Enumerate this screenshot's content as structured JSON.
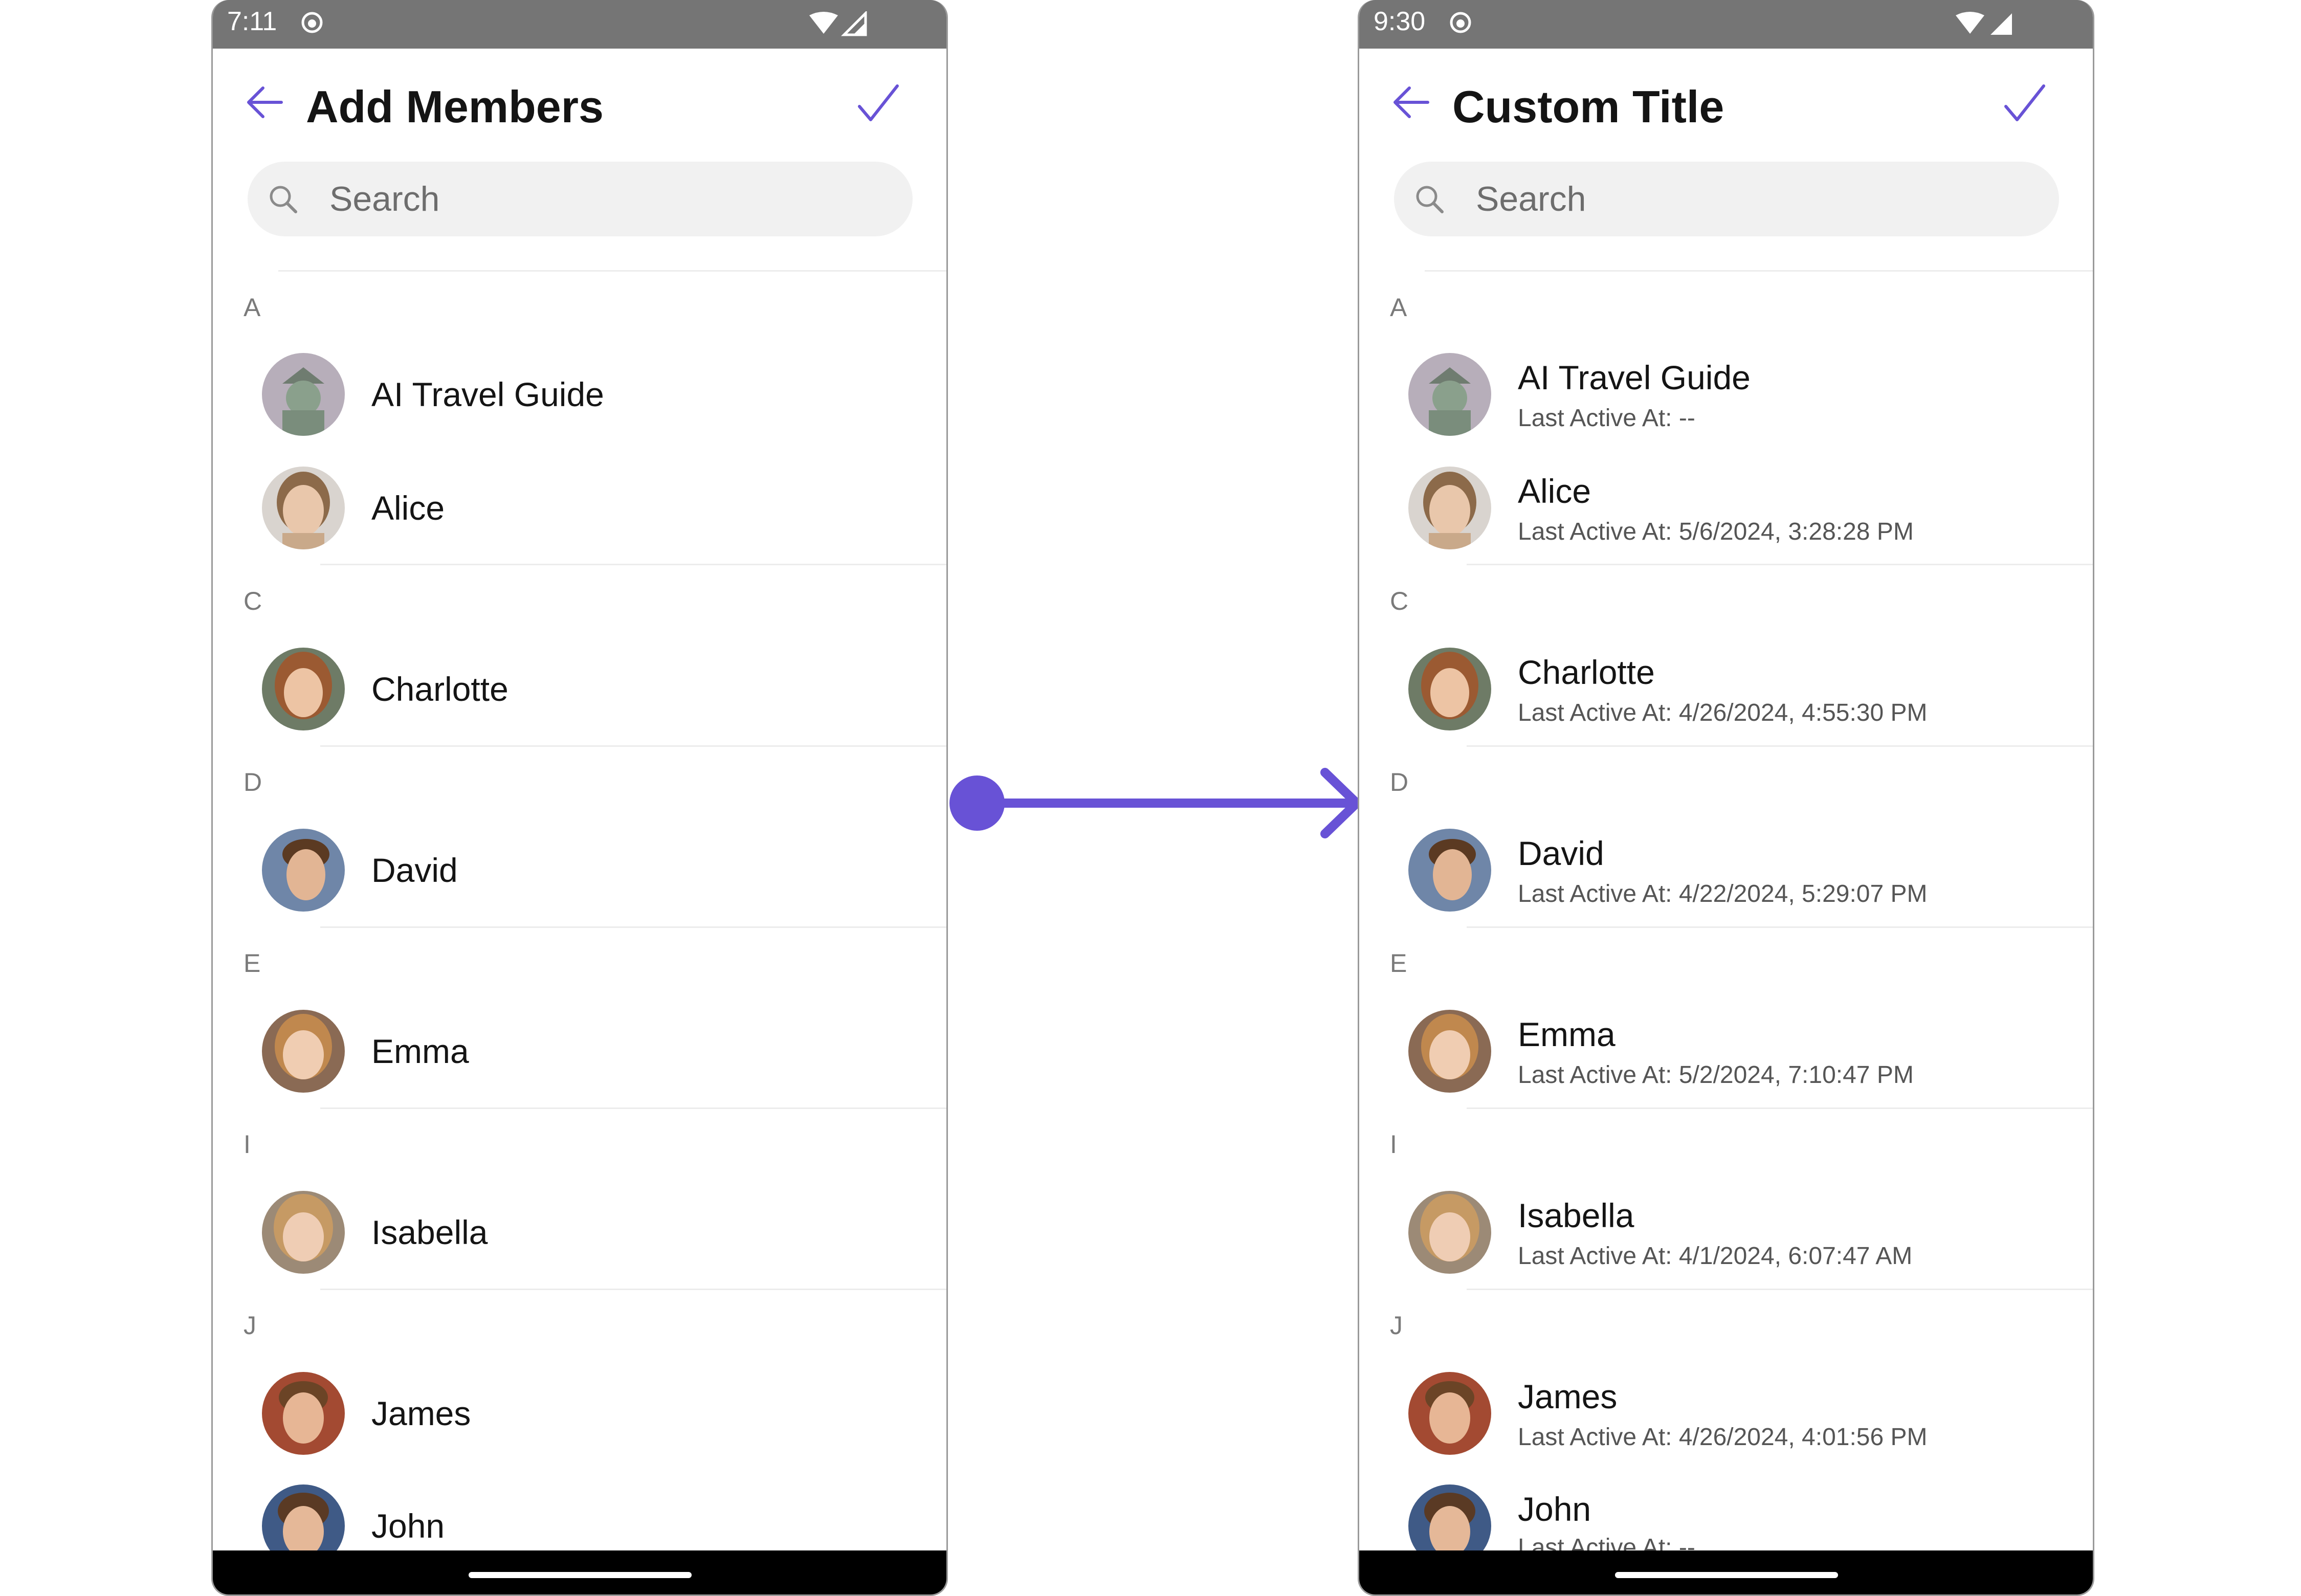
{
  "accent_color": "#6852d6",
  "left_screen": {
    "status_time": "7:11",
    "title": "Add Members",
    "search_placeholder": "Search",
    "sections": [
      {
        "letter": "A"
      },
      {
        "letter": "C"
      },
      {
        "letter": "D"
      },
      {
        "letter": "E"
      },
      {
        "letter": "I"
      },
      {
        "letter": "J"
      }
    ],
    "users": [
      {
        "name": "AI Travel Guide",
        "avatar": "statue-avatar"
      },
      {
        "name": "Alice",
        "avatar": "woman-avatar"
      },
      {
        "name": "Charlotte",
        "avatar": "woman-avatar"
      },
      {
        "name": "David",
        "avatar": "man-avatar"
      },
      {
        "name": "Emma",
        "avatar": "woman-avatar"
      },
      {
        "name": "Isabella",
        "avatar": "woman-avatar"
      },
      {
        "name": "James",
        "avatar": "man-avatar"
      },
      {
        "name": "John",
        "avatar": "man-avatar"
      }
    ]
  },
  "right_screen": {
    "status_time": "9:30",
    "title": "Custom Title",
    "search_placeholder": "Search",
    "sections": [
      {
        "letter": "A"
      },
      {
        "letter": "C"
      },
      {
        "letter": "D"
      },
      {
        "letter": "E"
      },
      {
        "letter": "I"
      },
      {
        "letter": "J"
      }
    ],
    "users": [
      {
        "name": "AI Travel Guide",
        "subtitle": "Last Active At: --",
        "avatar": "statue-avatar"
      },
      {
        "name": "Alice",
        "subtitle": "Last Active At: 5/6/2024, 3:28:28 PM",
        "avatar": "woman-avatar"
      },
      {
        "name": "Charlotte",
        "subtitle": "Last Active At: 4/26/2024, 4:55:30 PM",
        "avatar": "woman-avatar"
      },
      {
        "name": "David",
        "subtitle": "Last Active At: 4/22/2024, 5:29:07 PM",
        "avatar": "man-avatar"
      },
      {
        "name": "Emma",
        "subtitle": "Last Active At: 5/2/2024, 7:10:47 PM",
        "avatar": "woman-avatar"
      },
      {
        "name": "Isabella",
        "subtitle": "Last Active At: 4/1/2024, 6:07:47 AM",
        "avatar": "woman-avatar"
      },
      {
        "name": "James",
        "subtitle": "Last Active At: 4/26/2024, 4:01:56 PM",
        "avatar": "man-avatar"
      },
      {
        "name": "John",
        "subtitle": "Last Active At: --",
        "avatar": "man-avatar"
      }
    ]
  }
}
